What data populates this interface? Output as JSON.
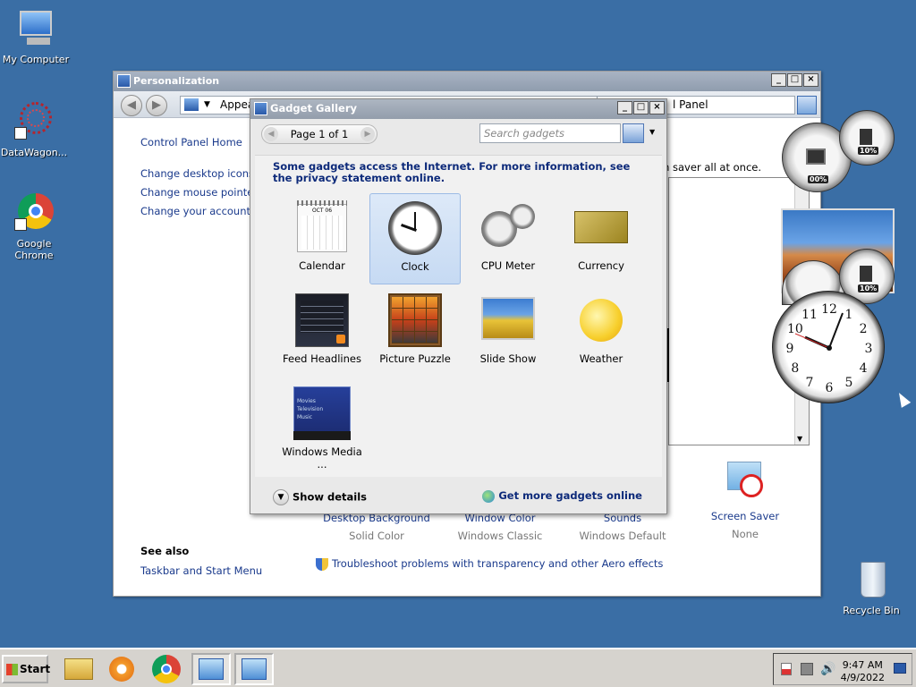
{
  "desktop": {
    "icons": [
      {
        "label": "My Computer"
      },
      {
        "label": "DataWagon..."
      },
      {
        "label": "Google Chrome"
      },
      {
        "label": "Recycle Bin"
      }
    ]
  },
  "personalization": {
    "title": "Personalization",
    "address_partial": "Appea",
    "address_right": "l Panel",
    "control_panel_home": "Control Panel Home",
    "tasks": [
      "Change desktop icons",
      "Change mouse pointers",
      "Change your account pic"
    ],
    "right_text": "en saver all at once.",
    "see_also_heading": "See also",
    "see_also_link": "Taskbar and Start Menu",
    "items": [
      {
        "label": "Desktop Background",
        "value": "Solid Color"
      },
      {
        "label": "Window Color",
        "value": "Windows Classic"
      },
      {
        "label": "Sounds",
        "value": "Windows Default"
      },
      {
        "label": "Screen Saver",
        "value": "None"
      }
    ],
    "troubleshoot": "Troubleshoot problems with transparency and other Aero effects"
  },
  "gallery": {
    "title": "Gadget Gallery",
    "page_label": "Page 1 of 1",
    "search_placeholder": "Search gadgets",
    "info": "Some gadgets access the Internet.  For more information, see the privacy statement online.",
    "gadgets": [
      {
        "label": "Calendar",
        "icon": "calendar-icon"
      },
      {
        "label": "Clock",
        "icon": "clock-icon",
        "selected": true
      },
      {
        "label": "CPU Meter",
        "icon": "cpu-meter-icon"
      },
      {
        "label": "Currency",
        "icon": "currency-icon"
      },
      {
        "label": "Feed Headlines",
        "icon": "feed-headlines-icon"
      },
      {
        "label": "Picture Puzzle",
        "icon": "picture-puzzle-icon"
      },
      {
        "label": "Slide Show",
        "icon": "slide-show-icon"
      },
      {
        "label": "Weather",
        "icon": "weather-icon"
      },
      {
        "label": "Windows Media ...",
        "icon": "windows-media-center-icon"
      }
    ],
    "calendar_month": "OCT 06",
    "media_lines": [
      "Movies",
      "Television",
      "Music"
    ],
    "show_details": "Show details",
    "get_more": "Get more gadgets online"
  },
  "desktop_gadgets": {
    "cpu_percent_1": "00%",
    "mem_percent_1": "10%",
    "mem_percent_2": "10%",
    "clock_numbers": [
      "12",
      "1",
      "2",
      "3",
      "4",
      "5",
      "6",
      "7",
      "8",
      "9",
      "10",
      "11"
    ]
  },
  "taskbar": {
    "start_label": "Start",
    "time": "9:47 AM",
    "date": "4/9/2022"
  }
}
